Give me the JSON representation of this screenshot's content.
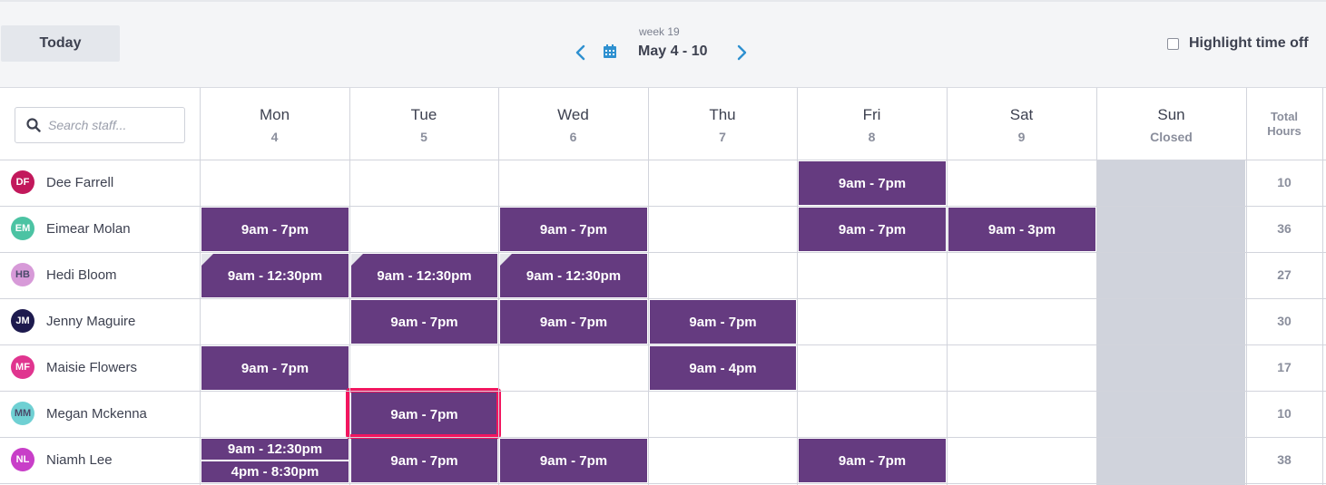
{
  "toolbar": {
    "today_label": "Today",
    "highlight_label": "Highlight time off"
  },
  "week": {
    "label": "week 19",
    "range": "May 4 - 10"
  },
  "search": {
    "placeholder": "Search staff..."
  },
  "days": [
    {
      "name": "Mon",
      "date": "4"
    },
    {
      "name": "Tue",
      "date": "5"
    },
    {
      "name": "Wed",
      "date": "6"
    },
    {
      "name": "Thu",
      "date": "7"
    },
    {
      "name": "Fri",
      "date": "8"
    },
    {
      "name": "Sat",
      "date": "9"
    },
    {
      "name": "Sun",
      "date": "Closed"
    }
  ],
  "total_header": {
    "line1": "Total",
    "line2": "Hours"
  },
  "staff": [
    {
      "initials": "DF",
      "name": "Dee Farrell",
      "color": "#c2185b",
      "total": "10",
      "shifts": [
        {
          "day": 4,
          "text": "9am - 7pm"
        }
      ]
    },
    {
      "initials": "EM",
      "name": "Eimear Molan",
      "color": "#4cc3a3",
      "total": "36",
      "shifts": [
        {
          "day": 0,
          "text": "9am - 7pm"
        },
        {
          "day": 2,
          "text": "9am - 7pm"
        },
        {
          "day": 4,
          "text": "9am - 7pm"
        },
        {
          "day": 5,
          "text": "9am - 3pm"
        }
      ]
    },
    {
      "initials": "HB",
      "name": "Hedi Bloom",
      "color": "#d79ad8",
      "total": "27",
      "shifts": [
        {
          "day": 0,
          "text": "9am - 12:30pm",
          "notch": true
        },
        {
          "day": 1,
          "text": "9am - 12:30pm",
          "notch": true
        },
        {
          "day": 2,
          "text": "9am - 12:30pm",
          "notch": true
        }
      ]
    },
    {
      "initials": "JM",
      "name": "Jenny Maguire",
      "color": "#1d1a4e",
      "total": "30",
      "shifts": [
        {
          "day": 1,
          "text": "9am - 7pm"
        },
        {
          "day": 2,
          "text": "9am - 7pm"
        },
        {
          "day": 3,
          "text": "9am - 7pm"
        }
      ]
    },
    {
      "initials": "MF",
      "name": "Maisie Flowers",
      "color": "#e0358f",
      "total": "17",
      "shifts": [
        {
          "day": 0,
          "text": "9am - 7pm"
        },
        {
          "day": 3,
          "text": "9am - 4pm"
        }
      ]
    },
    {
      "initials": "MM",
      "name": "Megan Mckenna",
      "color": "#6fd0d3",
      "total": "10",
      "shifts": [
        {
          "day": 1,
          "text": "9am - 7pm",
          "selected": true
        }
      ]
    },
    {
      "initials": "NL",
      "name": "Niamh Lee",
      "color": "#c83ec8",
      "total": "38",
      "shifts": [
        {
          "day": 0,
          "text": "9am - 12:30pm",
          "split": "top"
        },
        {
          "day": 0,
          "text": "4pm - 8:30pm",
          "split": "bottom"
        },
        {
          "day": 1,
          "text": "9am - 7pm"
        },
        {
          "day": 2,
          "text": "9am - 7pm"
        },
        {
          "day": 4,
          "text": "9am - 7pm"
        }
      ]
    }
  ],
  "colors": {
    "shift": "#653b80",
    "selected_outline": "#f2165f",
    "accent": "#2e90d0",
    "closed": "#d0d3dc"
  }
}
